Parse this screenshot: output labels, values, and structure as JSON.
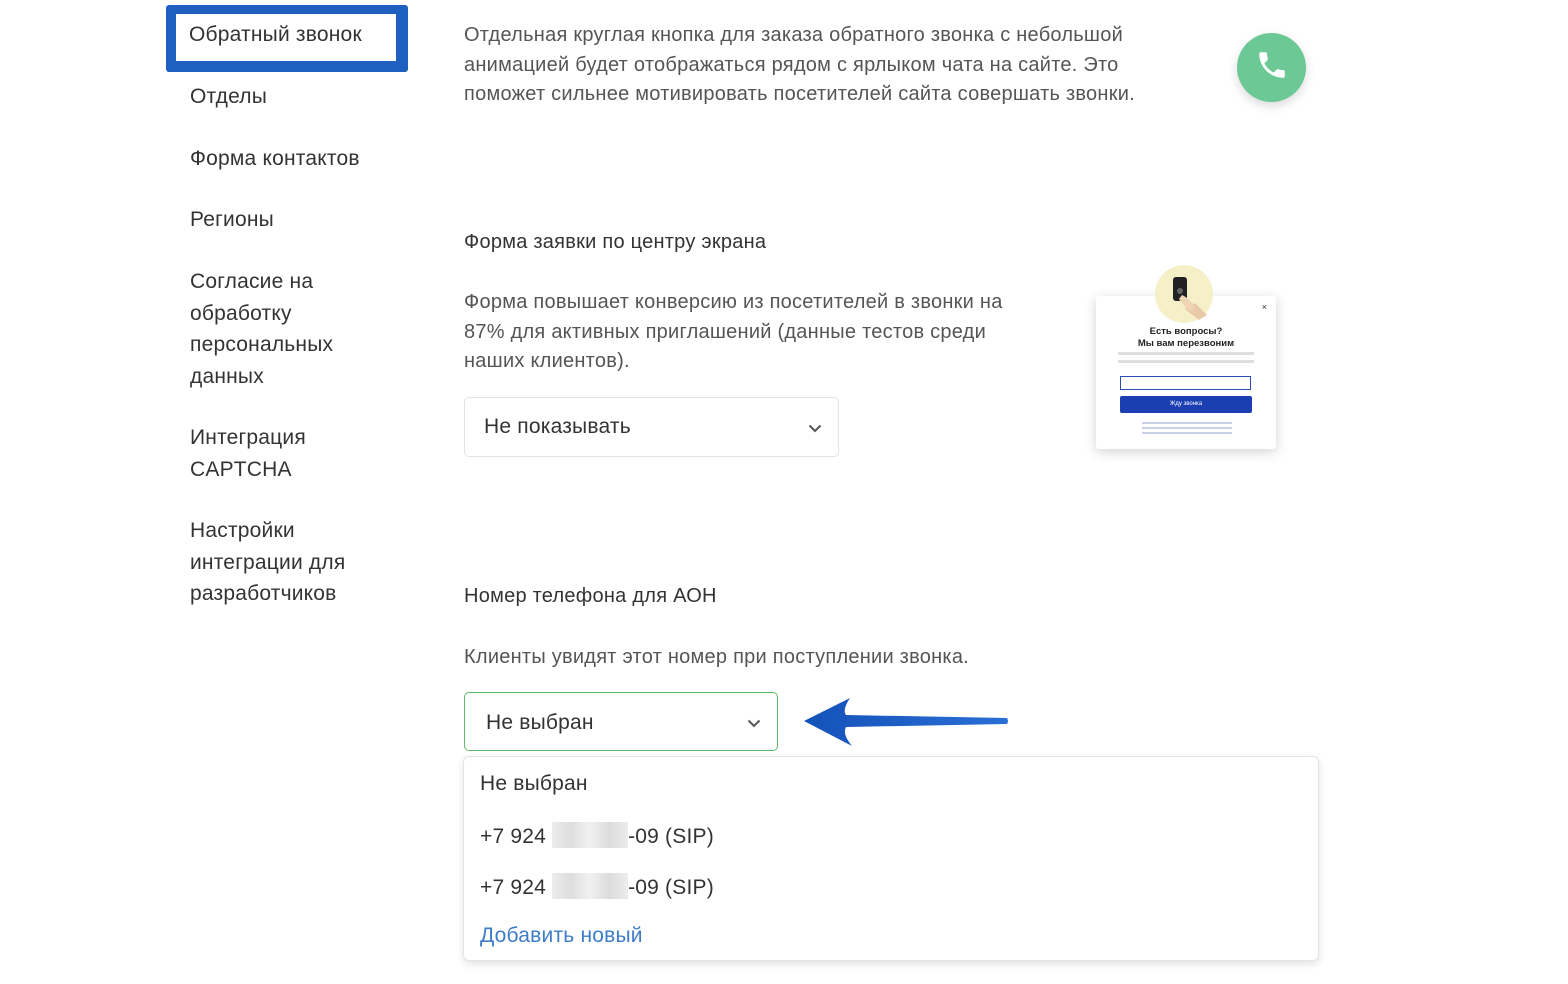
{
  "sidebar": {
    "active": "Обратный звонок",
    "items": [
      {
        "lines": [
          "Отделы"
        ]
      },
      {
        "lines": [
          "Форма контактов"
        ]
      },
      {
        "lines": [
          "Регионы"
        ]
      },
      {
        "lines": [
          "Согласие на",
          "обработку",
          "персональных",
          "данных"
        ]
      },
      {
        "lines": [
          "Интеграция",
          "CAPTCHA"
        ]
      },
      {
        "lines": [
          "Настройки",
          "интеграции для",
          "разработчиков"
        ]
      }
    ]
  },
  "callback": {
    "description_lines": [
      "Отдельная круглая кнопка для заказа обратного звонка с небольшой",
      "анимацией будет отображаться рядом с ярлыком чата на сайте. Это",
      "поможет сильнее мотивировать посетителей сайта совершать звонки."
    ],
    "button_icon": "phone-icon",
    "button_color": "#6cc894"
  },
  "center_form": {
    "title": "Форма заявки по центру экрана",
    "description_lines": [
      "Форма повышает конверсию из посетителей в звонки на",
      "87% для активных приглашений (данные тестов среди",
      "наших клиентов)."
    ],
    "select_value": "Не показывать",
    "preview": {
      "close": "×",
      "title_line1": "Есть вопросы?",
      "title_line2": "Мы вам перезвоним",
      "button": "Жду звонка"
    }
  },
  "caller_id": {
    "title": "Номер телефона для АОН",
    "description": "Клиенты увидят этот номер при поступлении звонка.",
    "select_value": "Не выбран",
    "options": [
      {
        "label": "Не выбран"
      },
      {
        "prefix": "+7 924",
        "suffix": "-09 (SIP)"
      },
      {
        "prefix": "+7 924",
        "suffix": "-09 (SIP)"
      }
    ],
    "add_new": "Добавить новый"
  },
  "colors": {
    "accent_blue": "#1f5fbf",
    "link_blue": "#3d7cc9",
    "focus_green": "#5fba6a",
    "arrow_blue": "#1a5bbf"
  }
}
